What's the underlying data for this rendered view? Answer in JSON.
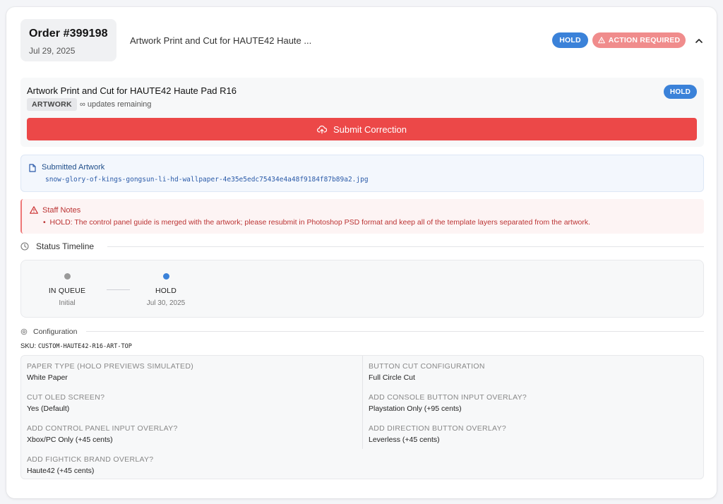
{
  "order": {
    "number": "Order #399198",
    "date": "Jul 29, 2025",
    "title": "Artwork Print and Cut for HAUTE42 Haute ...",
    "status_badge": "HOLD",
    "action_badge": "ACTION REQUIRED"
  },
  "item": {
    "title": "Artwork Print and Cut for HAUTE42 Haute Pad R16",
    "status_badge": "HOLD",
    "tag": "ARTWORK",
    "updates": "∞ updates remaining",
    "submit_label": "Submit Correction"
  },
  "artwork": {
    "label": "Submitted Artwork",
    "filename": "snow-glory-of-kings-gongsun-li-hd-wallpaper-4e35e5edc75434e4a48f9184f87b89a2.jpg"
  },
  "notes": {
    "label": "Staff Notes",
    "items": [
      "HOLD: The control panel guide is merged with the artwork; please resubmit in Photoshop PSD format and keep all of the template layers separated from the artwork."
    ]
  },
  "timeline": {
    "title": "Status Timeline",
    "steps": [
      {
        "label": "IN QUEUE",
        "sub": "Initial",
        "color": "#9a9a9a"
      },
      {
        "label": "HOLD",
        "sub": "Jul 30, 2025",
        "color": "#3b82d9"
      }
    ]
  },
  "configuration": {
    "title": "Configuration",
    "sku_label": "SKU:",
    "sku": "CUSTOM-HAUTE42-R16-ART-TOP",
    "fields": [
      {
        "label": "PAPER TYPE (HOLO PREVIEWS SIMULATED)",
        "value": "White Paper"
      },
      {
        "label": "BUTTON CUT CONFIGURATION",
        "value": "Full Circle Cut"
      },
      {
        "label": "CUT OLED SCREEN?",
        "value": "Yes (Default)"
      },
      {
        "label": "ADD CONSOLE BUTTON INPUT OVERLAY?",
        "value": "Playstation Only (+95 cents)"
      },
      {
        "label": "ADD CONTROL PANEL INPUT OVERLAY?",
        "value": "Xbox/PC Only (+45 cents)"
      },
      {
        "label": "ADD DIRECTION BUTTON OVERLAY?",
        "value": "Leverless (+45 cents)"
      },
      {
        "label": "ADD FIGHTICK BRAND OVERLAY?",
        "value": "Haute42 (+45 cents)"
      }
    ]
  },
  "colors": {
    "accent_blue": "#3b82d9",
    "danger_red": "#ec4848",
    "action_pink": "#f08c8c"
  }
}
